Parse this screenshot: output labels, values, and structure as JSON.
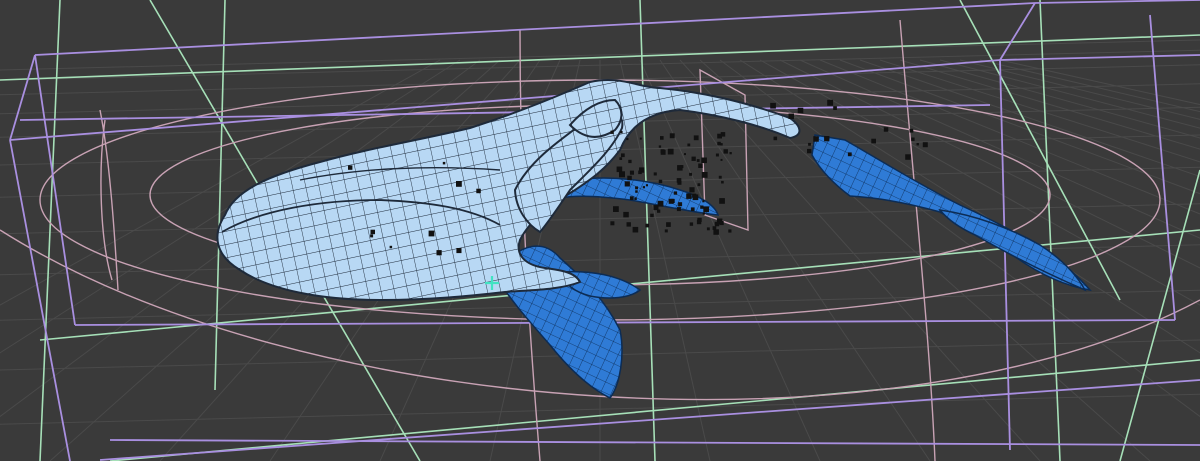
{
  "viewport": {
    "background": "#3a3a3a",
    "grid_color": "#4a4a4a",
    "lattice_color": "#a98fe0",
    "green_cage_color": "#a6e0b8",
    "pink_cage_color": "#c8a2b4",
    "mesh_fill": "#b8d8f4",
    "mesh_wire": "#1e2a3a",
    "fin_fill": "#2f7bd6",
    "fin_wire": "#0c2c55",
    "particle_color": "#111111",
    "manipulator_color": "#42e3c2"
  },
  "scene": {
    "mesh_icon": "whale-mesh-icon",
    "manipulator_icon": "pivot-cross-icon"
  }
}
